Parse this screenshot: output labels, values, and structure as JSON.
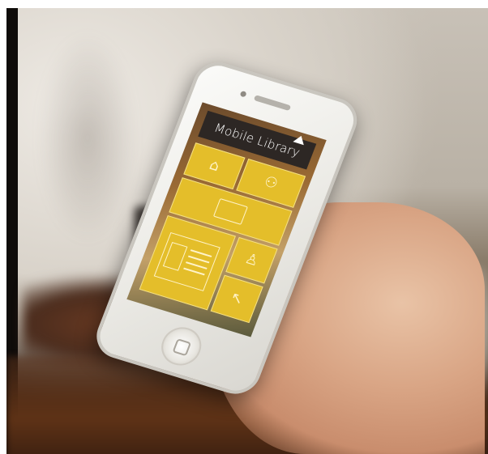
{
  "app": {
    "title": "Mobile Library"
  },
  "tiles": [
    {
      "id": "tile-1",
      "icon": "library-building-icon",
      "glyph": "⌂"
    },
    {
      "id": "tile-2",
      "icon": "people-group-icon",
      "glyph": "⚇"
    },
    {
      "id": "tile-3",
      "icon": "computer-screen-icon",
      "glyph": ""
    },
    {
      "id": "tile-4",
      "icon": "document-layout-icon",
      "glyph": ""
    },
    {
      "id": "tile-5",
      "icon": "user-profile-icon",
      "glyph": "♙"
    },
    {
      "id": "tile-6",
      "icon": "cursor-pointer-icon",
      "glyph": "↖"
    }
  ],
  "colors": {
    "tile_yellow": "#e4be2a",
    "header_dark": "#2d2724",
    "phone_white": "#f5f4f0"
  }
}
